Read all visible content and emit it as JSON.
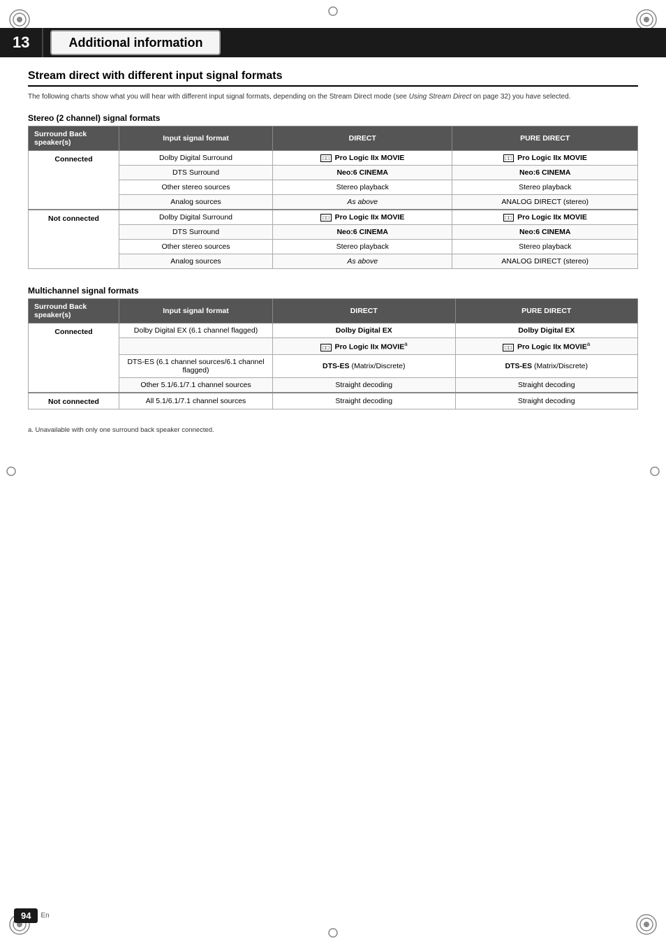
{
  "chapter": {
    "number": "13",
    "title": "Additional information"
  },
  "section": {
    "title": "Stream direct with different input signal formats",
    "intro": "The following charts show what you will hear with different input signal formats, depending on the Stream Direct mode (see Using Stream Direct on page 32) you have selected."
  },
  "stereo_table": {
    "subsection": "Stereo (2 channel) signal formats",
    "headers": [
      "Surround Back speaker(s)",
      "Input signal format",
      "DIRECT",
      "PURE DIRECT"
    ],
    "groups": [
      {
        "speaker": "Connected",
        "rows": [
          {
            "input": "Dolby Digital Surround",
            "direct": "Pro Logic IIx MOVIE",
            "pure": "Pro Logic IIx MOVIE",
            "direct_bold": true,
            "pure_bold": true,
            "has_icon": true
          },
          {
            "input": "DTS Surround",
            "direct": "Neo:6 CINEMA",
            "pure": "Neo:6 CINEMA",
            "direct_bold": true,
            "pure_bold": true
          },
          {
            "input": "Other stereo sources",
            "direct": "Stereo playback",
            "pure": "Stereo playback",
            "direct_bold": false,
            "pure_bold": false
          },
          {
            "input": "Analog sources",
            "direct": "As above",
            "pure": "ANALOG DIRECT (stereo)",
            "direct_italic": true,
            "direct_bold": false,
            "pure_bold": false
          }
        ]
      },
      {
        "speaker": "Not connected",
        "rows": [
          {
            "input": "Dolby Digital Surround",
            "direct": "Pro Logic IIx MOVIE",
            "pure": "Pro Logic IIx MOVIE",
            "direct_bold": true,
            "pure_bold": true,
            "has_icon": true
          },
          {
            "input": "DTS Surround",
            "direct": "Neo:6 CINEMA",
            "pure": "Neo:6 CINEMA",
            "direct_bold": true,
            "pure_bold": true
          },
          {
            "input": "Other stereo sources",
            "direct": "Stereo playback",
            "pure": "Stereo playback",
            "direct_bold": false,
            "pure_bold": false
          },
          {
            "input": "Analog sources",
            "direct": "As above",
            "pure": "ANALOG DIRECT (stereo)",
            "direct_italic": true,
            "direct_bold": false,
            "pure_bold": false
          }
        ]
      }
    ]
  },
  "multichannel_table": {
    "subsection": "Multichannel signal formats",
    "headers": [
      "Surround Back speaker(s)",
      "Input signal format",
      "DIRECT",
      "PURE DIRECT"
    ],
    "groups": [
      {
        "speaker": "Connected",
        "rows": [
          {
            "input": "Dolby Digital EX (6.1 channel flagged)",
            "direct": "Dolby Digital EX",
            "pure": "Dolby Digital EX",
            "direct_bold": true,
            "pure_bold": true
          },
          {
            "input": "",
            "direct": "Pro Logic IIx MOVIE",
            "pure": "Pro Logic IIx MOVIE",
            "direct_bold": true,
            "pure_bold": true,
            "has_icon": true,
            "footnote_ref": "a"
          },
          {
            "input": "DTS-ES (6.1 channel sources/6.1 channel flagged)",
            "direct": "DTS-ES (Matrix/Discrete)",
            "pure": "DTS-ES (Matrix/Discrete)",
            "direct_bold": true,
            "pure_bold": true
          },
          {
            "input": "Other 5.1/6.1/7.1 channel sources",
            "direct": "Straight decoding",
            "pure": "Straight decoding",
            "direct_bold": false,
            "pure_bold": false
          }
        ]
      },
      {
        "speaker": "Not connected",
        "rows": [
          {
            "input": "All 5.1/6.1/7.1 channel sources",
            "direct": "Straight decoding",
            "pure": "Straight decoding",
            "direct_bold": false,
            "pure_bold": false
          }
        ]
      }
    ]
  },
  "footnote": "a. Unavailable with only one surround back speaker connected.",
  "page": {
    "number": "94",
    "lang": "En"
  }
}
